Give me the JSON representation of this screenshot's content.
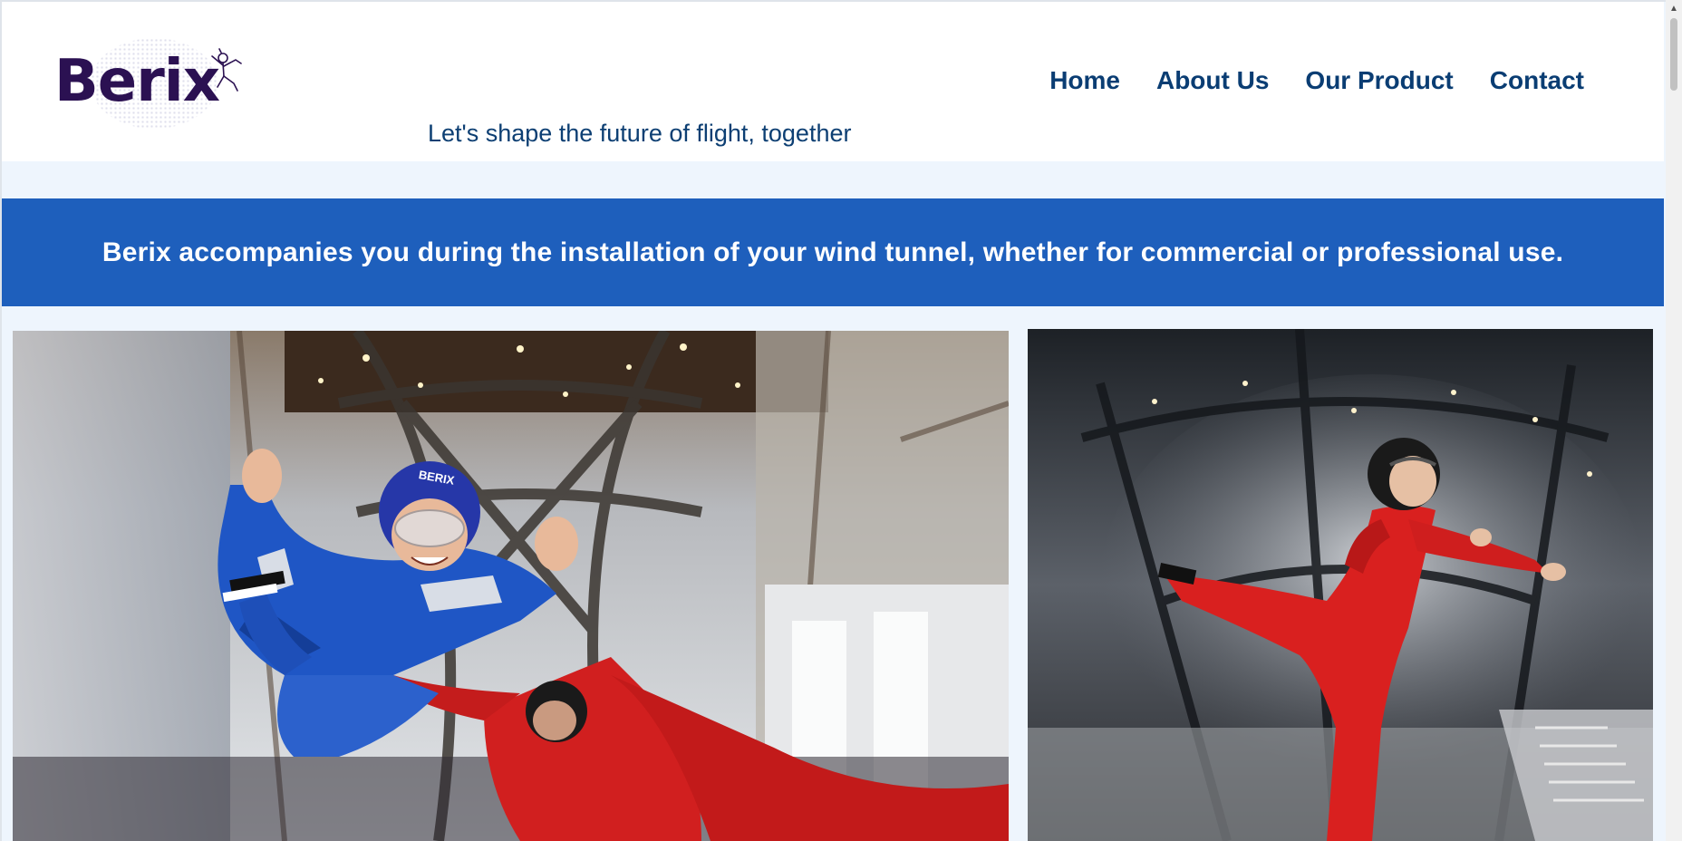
{
  "header": {
    "logo_text": "Berix",
    "tagline": "Let's shape the future of flight, together"
  },
  "nav": {
    "items": [
      {
        "label": "Home"
      },
      {
        "label": "About Us"
      },
      {
        "label": "Our Product"
      },
      {
        "label": "Contact"
      }
    ]
  },
  "banner": {
    "text": "Berix accompanies you during the installation of your wind tunnel, whether for commercial or professional use."
  },
  "photos": {
    "left_helmet_text": "BERIX"
  },
  "colors": {
    "brand_purple": "#2b1152",
    "nav_blue": "#0a3d73",
    "banner_blue": "#1e5fbc",
    "page_background": "#eef5fd"
  },
  "icons": {
    "logo_mark": "skydiver-icon",
    "scroll_up": "chevron-up-icon"
  }
}
